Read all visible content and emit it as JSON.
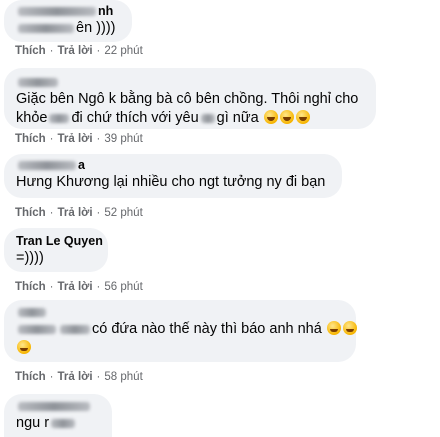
{
  "comments": [
    {
      "name_parts": [
        "nh"
      ],
      "text_parts": [
        "ên ))))"
      ],
      "action_like": "Thích",
      "action_reply": "Trả lời",
      "time": "22 phút"
    },
    {
      "name_parts": [],
      "text_line1": "Giặc bên Ngô k bằng bà cô bên chồng. Thôi nghỉ cho",
      "text_line2_parts": [
        "khỏe",
        "đi chứ thích với yêu",
        "gì nữa"
      ],
      "emojis": [
        "laughing-crying-emoji",
        "laughing-crying-emoji",
        "laughing-crying-emoji"
      ],
      "action_like": "Thích",
      "action_reply": "Trả lời",
      "time": "39 phút"
    },
    {
      "name_parts": [
        "a"
      ],
      "text": "Hưng Khương lại nhiều cho ngt tưởng ny đi bạn",
      "action_like": "Thích",
      "action_reply": "Trả lời",
      "time": "52 phút"
    },
    {
      "name": "Tran Le Quyen",
      "text": "=))))",
      "action_like": "Thích",
      "action_reply": "Trả lời",
      "time": "56 phút"
    },
    {
      "name_parts": [],
      "text_parts": [
        "có đứa nào thế này thì báo anh nhá"
      ],
      "emojis": [
        "grinning-emoji",
        "grinning-emoji",
        "grinning-emoji"
      ],
      "action_like": "Thích",
      "action_reply": "Trả lời",
      "time": "58 phút"
    },
    {
      "name_parts": [],
      "text_parts": [
        "ngu r"
      ]
    }
  ],
  "separator": "·",
  "colors": {
    "bubble": "#f0f2f5",
    "meta": "#65676b",
    "text": "#050505"
  }
}
